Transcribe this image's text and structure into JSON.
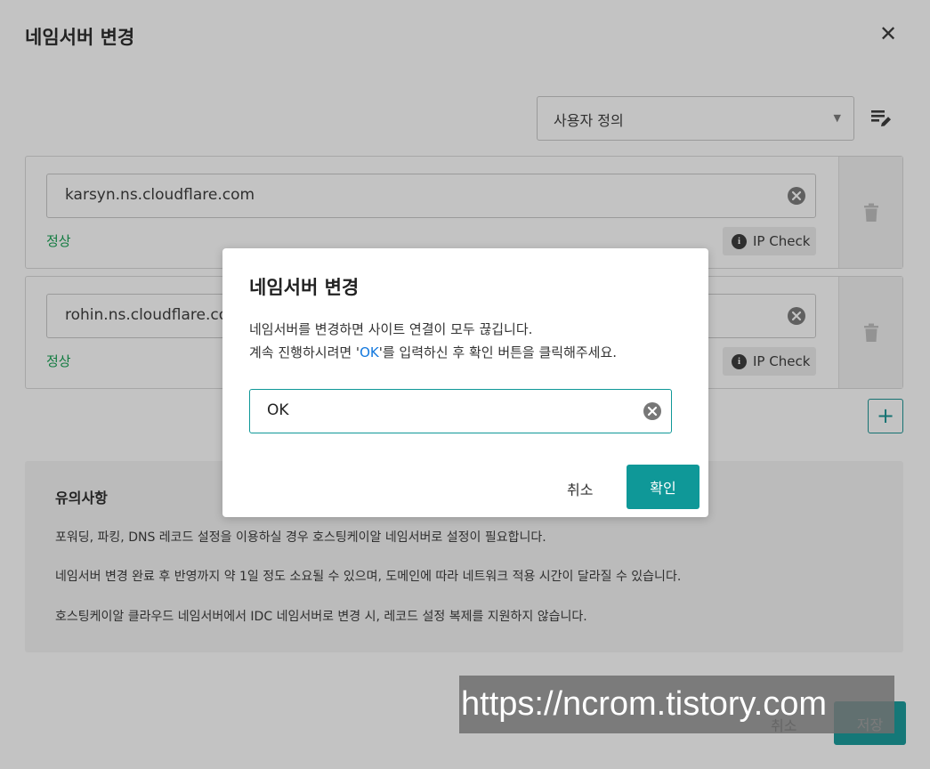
{
  "dialog": {
    "title": "네임서버 변경",
    "preset": {
      "value": "사용자 정의"
    },
    "nameservers": [
      {
        "value": "karsyn.ns.cloudflare.com",
        "status": "정상",
        "ip_check": "IP Check"
      },
      {
        "value": "rohin.ns.cloudflare.com",
        "status": "정상",
        "ip_check": "IP Check"
      }
    ],
    "notice": {
      "heading": "유의사항",
      "lines": [
        "포워딩, 파킹, DNS 레코드 설정을 이용하실 경우 호스팅케이알 네임서버로 설정이 필요합니다.",
        "네임서버 변경 완료 후 반영까지 약 1일 정도 소요될 수 있으며, 도메인에 따라 네트워크 적용 시간이 달라질 수 있습니다.",
        "호스팅케이알 클라우드 네임서버에서 IDC 네임서버로 변경 시, 레코드 설정 복제를 지원하지 않습니다."
      ]
    },
    "footer": {
      "cancel": "취소",
      "save": "저장"
    }
  },
  "confirm_modal": {
    "title": "네임서버 변경",
    "line1": "네임서버를 변경하면 사이트 연결이 모두 끊깁니다.",
    "line2_pre": "계속 진행하시려면 '",
    "line2_ok": "OK",
    "line2_post": "'를 입력하신 후 확인 버튼을 클릭해주세요.",
    "input_value": "OK",
    "cancel": "취소",
    "confirm": "확인"
  },
  "watermark": "https://ncrom.tistory.com",
  "colors": {
    "accent": "#0f9898",
    "status_ok": "#0a9c4a",
    "link": "#1177dd"
  }
}
